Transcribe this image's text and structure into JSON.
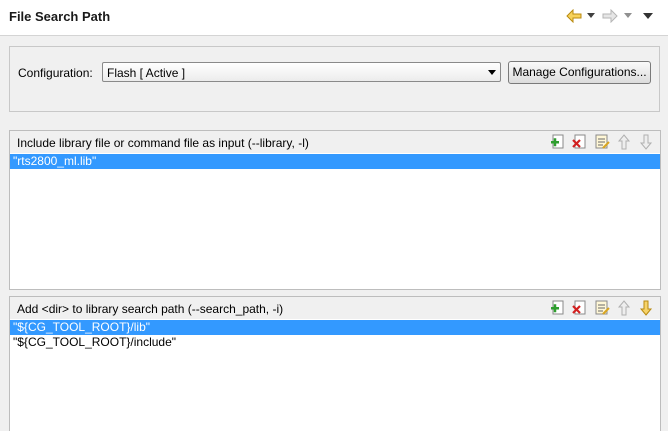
{
  "header": {
    "title": "File Search Path",
    "back_icon": "back-arrow-icon",
    "forward_icon": "forward-arrow-icon",
    "menu_icon": "view-menu-icon"
  },
  "config": {
    "label": "Configuration:",
    "selected": "Flash  [ Active ]",
    "manage_label": "Manage Configurations..."
  },
  "include_panel": {
    "title": "Include library file or command file as input (--library, -l)",
    "items": [
      "\"rts2800_ml.lib\""
    ],
    "tools": [
      "add-icon",
      "delete-icon",
      "edit-icon",
      "move-up-icon",
      "move-down-icon"
    ]
  },
  "search_panel": {
    "title": "Add <dir> to library search path (--search_path, -i)",
    "items": [
      "\"${CG_TOOL_ROOT}/lib\"",
      "\"${CG_TOOL_ROOT}/include\""
    ],
    "tools": [
      "add-icon",
      "delete-icon",
      "edit-icon",
      "move-up-icon",
      "move-down-icon"
    ]
  },
  "colors": {
    "selection": "#3399ff",
    "back_arrow": "#e8b83a",
    "forward_arrow_disabled": "#c8c8c8"
  }
}
